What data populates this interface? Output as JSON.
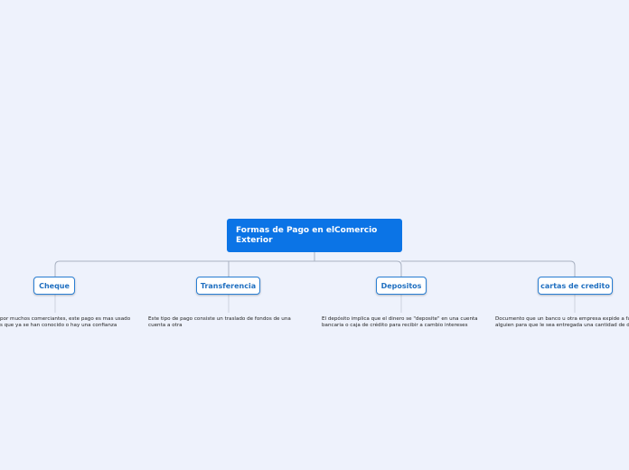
{
  "root": {
    "title": "Formas de Pago en elComercio Exterior"
  },
  "branches": [
    {
      "label": "Cheque",
      "desc": [
        "por muchos comerciantes, este pago es mas usado",
        "s que ya se han conocido o hay una confianza"
      ]
    },
    {
      "label": "Transferencia",
      "desc": [
        "Este tipo de pago consiste un traslado de fondos de una",
        "cuenta a otra"
      ]
    },
    {
      "label": "Depositos",
      "desc": [
        "El depósito implica que el dinero se \"deposite\" en una cuenta",
        "bancaria o caja de crédito para recibir a cambio intereses"
      ]
    },
    {
      "label": "cartas de credito",
      "desc": [
        "Documento que un banco u otra empresa expide a fa",
        "alguien para que le sea entregada una cantidad de di"
      ]
    }
  ],
  "colors": {
    "background": "#eef2fc",
    "root_fill": "#0b74e6",
    "node_border": "#2a7fd4",
    "node_text": "#1f6fc0",
    "connector": "#a9b2c2"
  }
}
